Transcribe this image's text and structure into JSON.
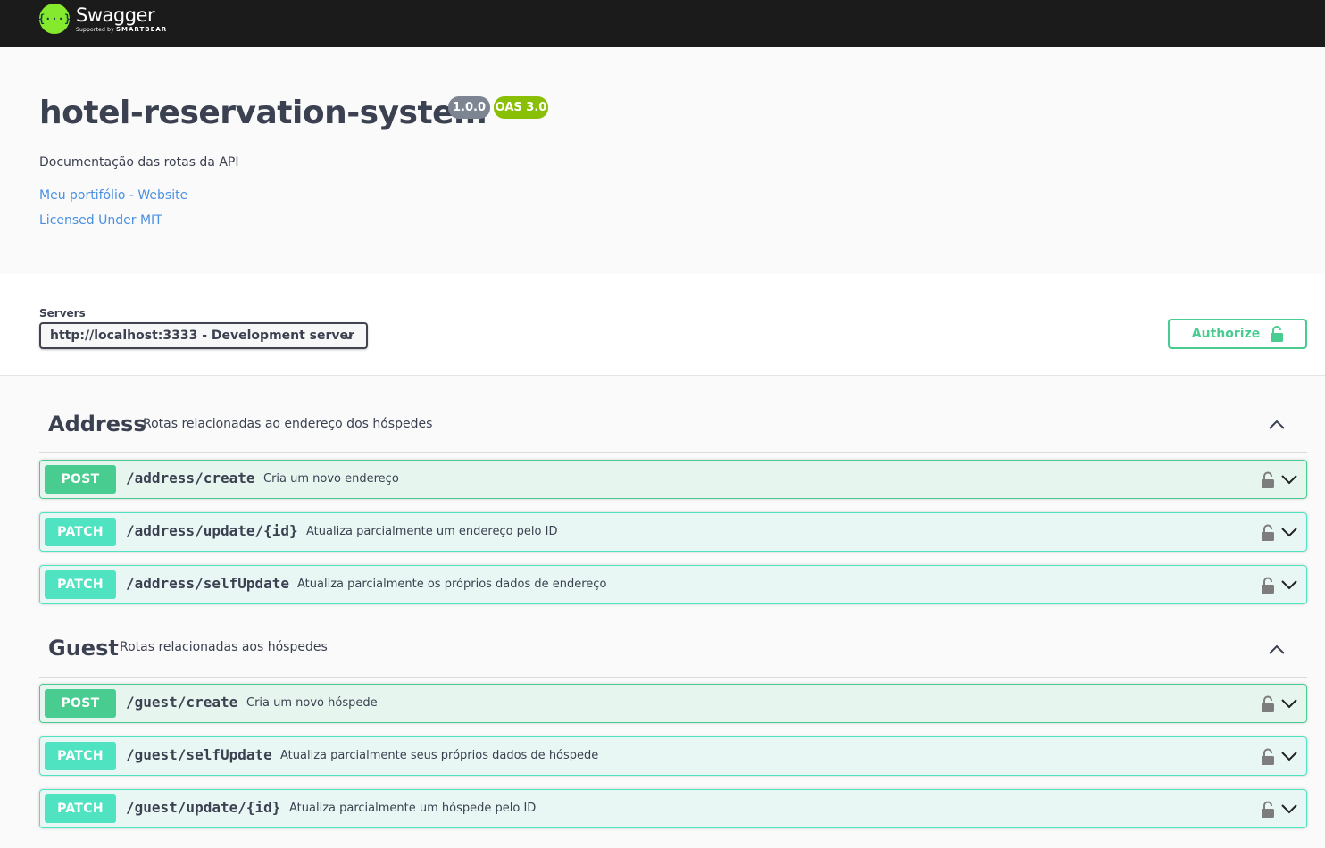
{
  "topbar": {
    "logo_icon": "{···}",
    "logo_name": "Swagger",
    "logo_supported": "Supported by",
    "logo_company": "SMARTBEAR"
  },
  "info": {
    "title": "hotel-reservation-system",
    "version": "1.0.0",
    "oas": "OAS 3.0",
    "description": "Documentação das rotas da API",
    "links": [
      "Meu portifólio - Website",
      "Licensed Under MIT"
    ]
  },
  "servers": {
    "label": "Servers",
    "selected": "http://localhost:3333 - Development server"
  },
  "authorize": {
    "label": "Authorize"
  },
  "colors": {
    "post": "#49cc90",
    "patch": "#50e3c2",
    "topbar": "#1b1b1b",
    "logo": "#85ea2d",
    "link": "#4990e2"
  },
  "icons": [
    "swagger-logo-icon",
    "chevron-down-icon",
    "lock-open-icon",
    "chevron-up-icon",
    "lock-icon"
  ],
  "tags": [
    {
      "name": "Address",
      "description": "Rotas relacionadas ao endereço dos hóspedes",
      "operations": [
        {
          "method": "POST",
          "path": "/address/create",
          "summary": "Cria um novo endereço"
        },
        {
          "method": "PATCH",
          "path": "/address/update/{id}",
          "summary": "Atualiza parcialmente um endereço pelo ID"
        },
        {
          "method": "PATCH",
          "path": "/address/selfUpdate",
          "summary": "Atualiza parcialmente os próprios dados de endereço"
        }
      ]
    },
    {
      "name": "Guest",
      "description": "Rotas relacionadas aos hóspedes",
      "operations": [
        {
          "method": "POST",
          "path": "/guest/create",
          "summary": "Cria um novo hóspede"
        },
        {
          "method": "PATCH",
          "path": "/guest/selfUpdate",
          "summary": "Atualiza parcialmente seus próprios dados de hóspede"
        },
        {
          "method": "PATCH",
          "path": "/guest/update/{id}",
          "summary": "Atualiza parcialmente um hóspede pelo ID"
        }
      ]
    }
  ]
}
